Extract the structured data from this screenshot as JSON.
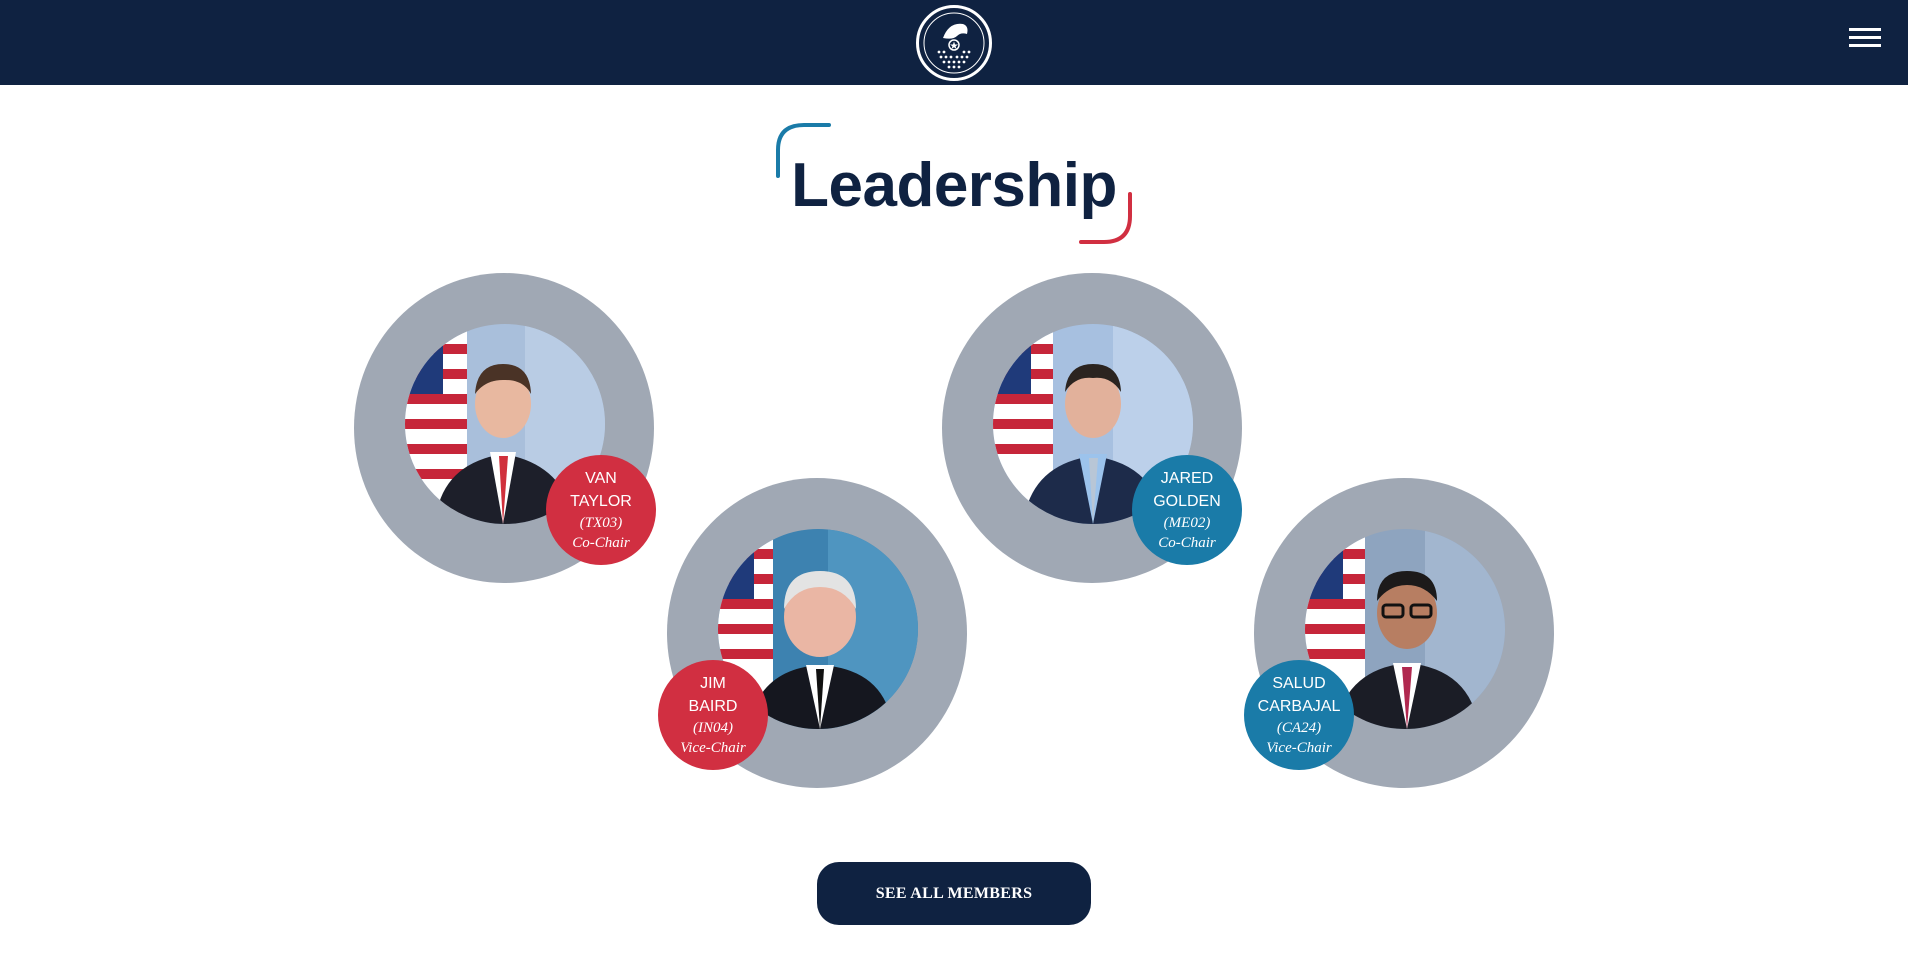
{
  "header": {
    "logo_icon": "caucus-for-country-seal",
    "menu_icon": "hamburger-menu-icon"
  },
  "section": {
    "title": "Leadership"
  },
  "members": [
    {
      "name_line1": "VAN",
      "name_line2": "TAYLOR",
      "district": "(TX03)",
      "role": "Co-Chair",
      "badge_color": "#d12f41"
    },
    {
      "name_line1": "JIM",
      "name_line2": "BAIRD",
      "district": "(IN04)",
      "role": "Vice-Chair",
      "badge_color": "#d12f41"
    },
    {
      "name_line1": "JARED",
      "name_line2": "GOLDEN",
      "district": "(ME02)",
      "role": "Co-Chair",
      "badge_color": "#1a7ba8"
    },
    {
      "name_line1": "SALUD",
      "name_line2": "CARBAJAL",
      "district": "(CA24)",
      "role": "Vice-Chair",
      "badge_color": "#1a7ba8"
    }
  ],
  "cta": {
    "label": "SEE ALL MEMBERS"
  },
  "colors": {
    "navy": "#0f2241",
    "red": "#d12f41",
    "blue": "#1a7ba8",
    "ring_gray": "#a0a8b4"
  }
}
